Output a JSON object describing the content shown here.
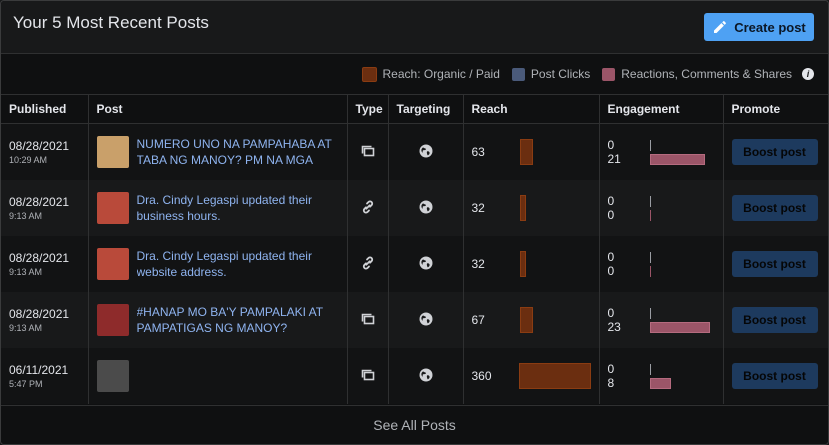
{
  "header": {
    "title": "Your 5 Most Recent Posts",
    "create_label": "Create post"
  },
  "legend": [
    {
      "label": "Reach: Organic / Paid",
      "color": "#6b2e10"
    },
    {
      "label": "Post Clicks",
      "color": "#4a5a7a"
    },
    {
      "label": "Reactions, Comments & Shares",
      "color": "#9b5568"
    }
  ],
  "columns": [
    "Published",
    "Post",
    "Type",
    "Targeting",
    "Reach",
    "Engagement",
    "Promote"
  ],
  "rows": [
    {
      "date": "08/28/2021",
      "time": "10:29 AM",
      "text": "NUMERO UNO NA PAMPAHABA AT TABA NG MANOY? PM NA MGA",
      "type": "album-icon",
      "reach": "63",
      "reach_value": 63,
      "clicks": "0",
      "reactions": "21",
      "reactions_value": 21,
      "boost": "Boost post",
      "thumb": "#c9a06a"
    },
    {
      "date": "08/28/2021",
      "time": "9:13 AM",
      "text": "Dra. Cindy Legaspi updated their business hours.",
      "type": "link-icon",
      "reach": "32",
      "reach_value": 32,
      "clicks": "0",
      "reactions": "0",
      "reactions_value": 0,
      "boost": "Boost post",
      "thumb": "#b94a3a"
    },
    {
      "date": "08/28/2021",
      "time": "9:13 AM",
      "text": "Dra. Cindy Legaspi updated their website address.",
      "type": "link-icon",
      "reach": "32",
      "reach_value": 32,
      "clicks": "0",
      "reactions": "0",
      "reactions_value": 0,
      "boost": "Boost post",
      "thumb": "#b94a3a"
    },
    {
      "date": "08/28/2021",
      "time": "9:13 AM",
      "text": "#HANAP MO BA'Y PAMPALAKI AT PAMPATIGAS NG MANOY?",
      "type": "album-icon",
      "reach": "67",
      "reach_value": 67,
      "clicks": "0",
      "reactions": "23",
      "reactions_value": 23,
      "boost": "Boost post",
      "thumb": "#8e2b2b"
    },
    {
      "date": "06/11/2021",
      "time": "5:47 PM",
      "text": "",
      "type": "album-icon",
      "reach": "360",
      "reach_value": 360,
      "clicks": "0",
      "reactions": "8",
      "reactions_value": 8,
      "boost": "Boost post",
      "thumb": "#4b4b4b"
    }
  ],
  "footer": {
    "see_all": "See All Posts"
  }
}
